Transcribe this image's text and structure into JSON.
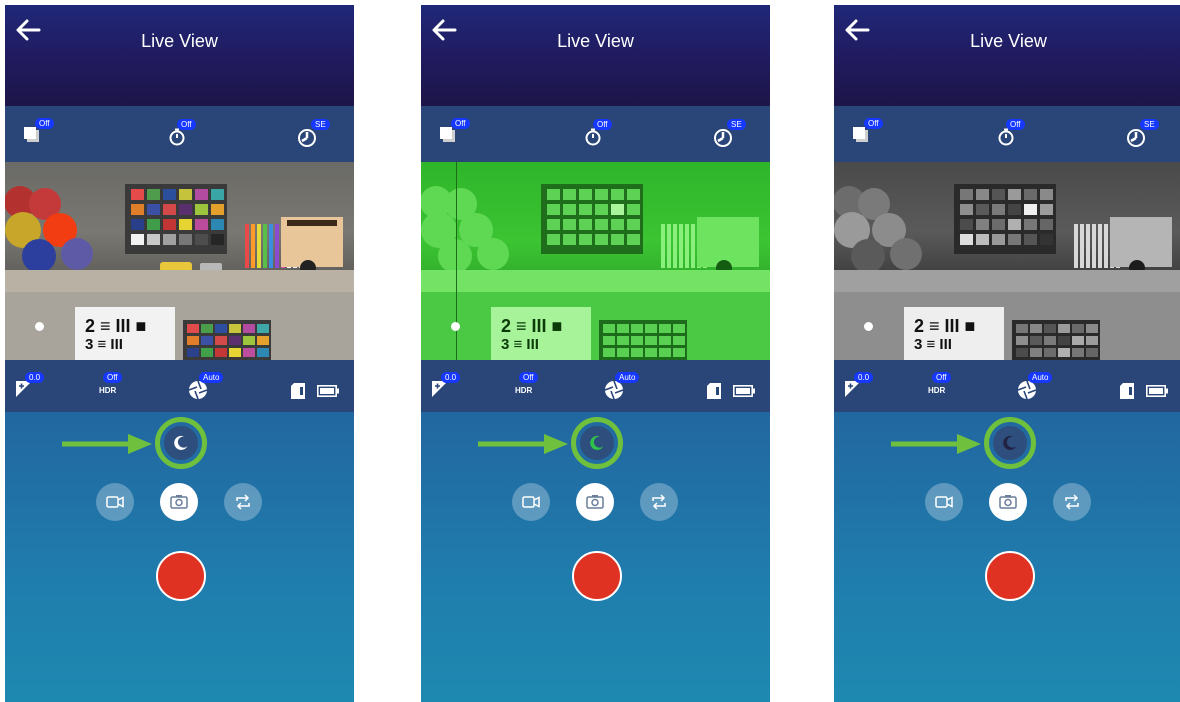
{
  "screens": [
    {
      "title": "Live View",
      "top_badges": {
        "burst": "Off",
        "timer": "Off",
        "shutter": "SE"
      },
      "bottom_badges": {
        "exposure": "0.0",
        "hdr_label": "HDR",
        "hdr": "Off",
        "aperture": "Auto"
      },
      "moon_color": "#ffffff",
      "view_mode": "color"
    },
    {
      "title": "Live View",
      "top_badges": {
        "burst": "Off",
        "timer": "Off",
        "shutter": "SE"
      },
      "bottom_badges": {
        "exposure": "0.0",
        "hdr_label": "HDR",
        "hdr": "Off",
        "aperture": "Auto"
      },
      "moon_color": "#2fc24a",
      "view_mode": "green"
    },
    {
      "title": "Live View",
      "top_badges": {
        "burst": "Off",
        "timer": "Off",
        "shutter": "SE"
      },
      "bottom_badges": {
        "exposure": "0.0",
        "hdr_label": "HDR",
        "hdr": "Off",
        "aperture": "Auto"
      },
      "moon_color": "#222244",
      "view_mode": "gray"
    }
  ],
  "colors": {
    "arrow": "#6fc13d",
    "badge": "#1738ff",
    "record": "#e03223",
    "panel": "#2a4679"
  },
  "icons": [
    "back-arrow-icon",
    "burst-icon",
    "timer-icon",
    "shutter-icon",
    "exposure-icon",
    "aperture-icon",
    "sd-card-icon",
    "battery-icon",
    "moon-icon",
    "video-camera-icon",
    "camera-icon",
    "switch-camera-icon"
  ]
}
